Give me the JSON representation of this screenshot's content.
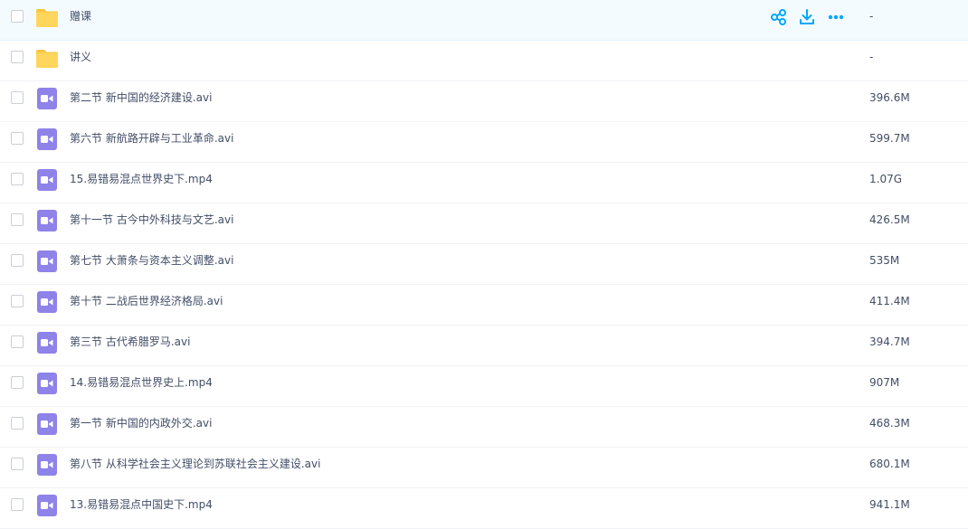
{
  "files": [
    {
      "name": "赠课",
      "size": "-",
      "type": "folder",
      "hovered": true
    },
    {
      "name": "讲义",
      "size": "-",
      "type": "folder"
    },
    {
      "name": "第二节 新中国的经济建设.avi",
      "size": "396.6M",
      "type": "video"
    },
    {
      "name": "第六节 新航路开辟与工业革命.avi",
      "size": "599.7M",
      "type": "video"
    },
    {
      "name": "15.易错易混点世界史下.mp4",
      "size": "1.07G",
      "type": "video"
    },
    {
      "name": "第十一节 古今中外科技与文艺.avi",
      "size": "426.5M",
      "type": "video"
    },
    {
      "name": "第七节 大萧条与资本主义调整.avi",
      "size": "535M",
      "type": "video"
    },
    {
      "name": "第十节 二战后世界经济格局.avi",
      "size": "411.4M",
      "type": "video"
    },
    {
      "name": "第三节 古代希腊罗马.avi",
      "size": "394.7M",
      "type": "video"
    },
    {
      "name": "14.易错易混点世界史上.mp4",
      "size": "907M",
      "type": "video"
    },
    {
      "name": "第一节 新中国的内政外交.avi",
      "size": "468.3M",
      "type": "video"
    },
    {
      "name": "第八节 从科学社会主义理论到苏联社会主义建设.avi",
      "size": "680.1M",
      "type": "video"
    },
    {
      "name": "13.易错易混点中国史下.mp4",
      "size": "941.1M",
      "type": "video"
    }
  ],
  "row_actions": {
    "share_icon": "share-icon",
    "download_icon": "download-icon",
    "more_icon": "more-icon"
  },
  "colors": {
    "folder": "#ffd65c",
    "folder_tab": "#f7c744",
    "video": "#8f82e8",
    "action": "#06a7ff",
    "hover_row": "#f4fbff"
  }
}
